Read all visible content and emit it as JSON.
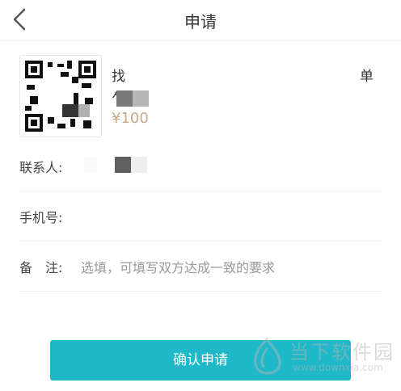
{
  "header": {
    "title": "申请",
    "back_icon": "chevron-left-icon"
  },
  "product": {
    "name_start": "找",
    "name_end": "单",
    "name_line2": "乍",
    "price": "¥100"
  },
  "form": {
    "contact_label": "联系人:",
    "phone_label": "手机号:",
    "remark_label": "备　注:",
    "remark_placeholder": "选填，可填写双方达成一致的要求"
  },
  "actions": {
    "confirm_label": "确认申请"
  },
  "watermark": {
    "text": "当下软件园",
    "url": "www.downxia.com"
  },
  "colors": {
    "accent": "#1fb8c8",
    "price": "#c7a98b",
    "placeholder": "#999999"
  }
}
